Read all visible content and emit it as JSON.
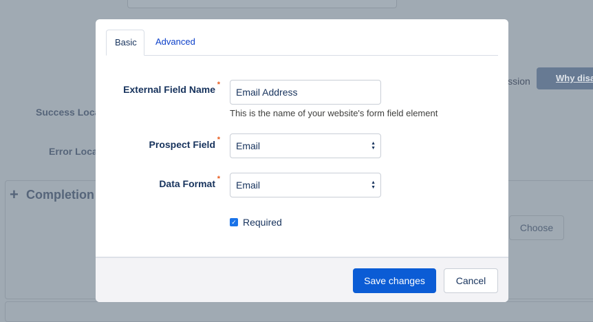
{
  "background": {
    "permission_fragment": "ission",
    "why_button": "Why disa",
    "success_label": "Success Loca",
    "error_label": "Error Loca",
    "completion_label": "Completion",
    "choose_button": "Choose"
  },
  "modal": {
    "tabs": [
      {
        "label": "Basic",
        "active": true
      },
      {
        "label": "Advanced",
        "active": false
      }
    ],
    "fields": {
      "external_field_name": {
        "label": "External Field Name",
        "value": "Email Address",
        "hint": "This is the name of your website's form field element"
      },
      "prospect_field": {
        "label": "Prospect Field",
        "value": "Email"
      },
      "data_format": {
        "label": "Data Format",
        "value": "Email"
      },
      "required": {
        "label": "Required",
        "checked": true
      }
    },
    "required_marker": "*",
    "save_label": "Save changes",
    "cancel_label": "Cancel"
  },
  "colors": {
    "primary": "#0b5cd5",
    "overlay": "#a0aab3"
  }
}
